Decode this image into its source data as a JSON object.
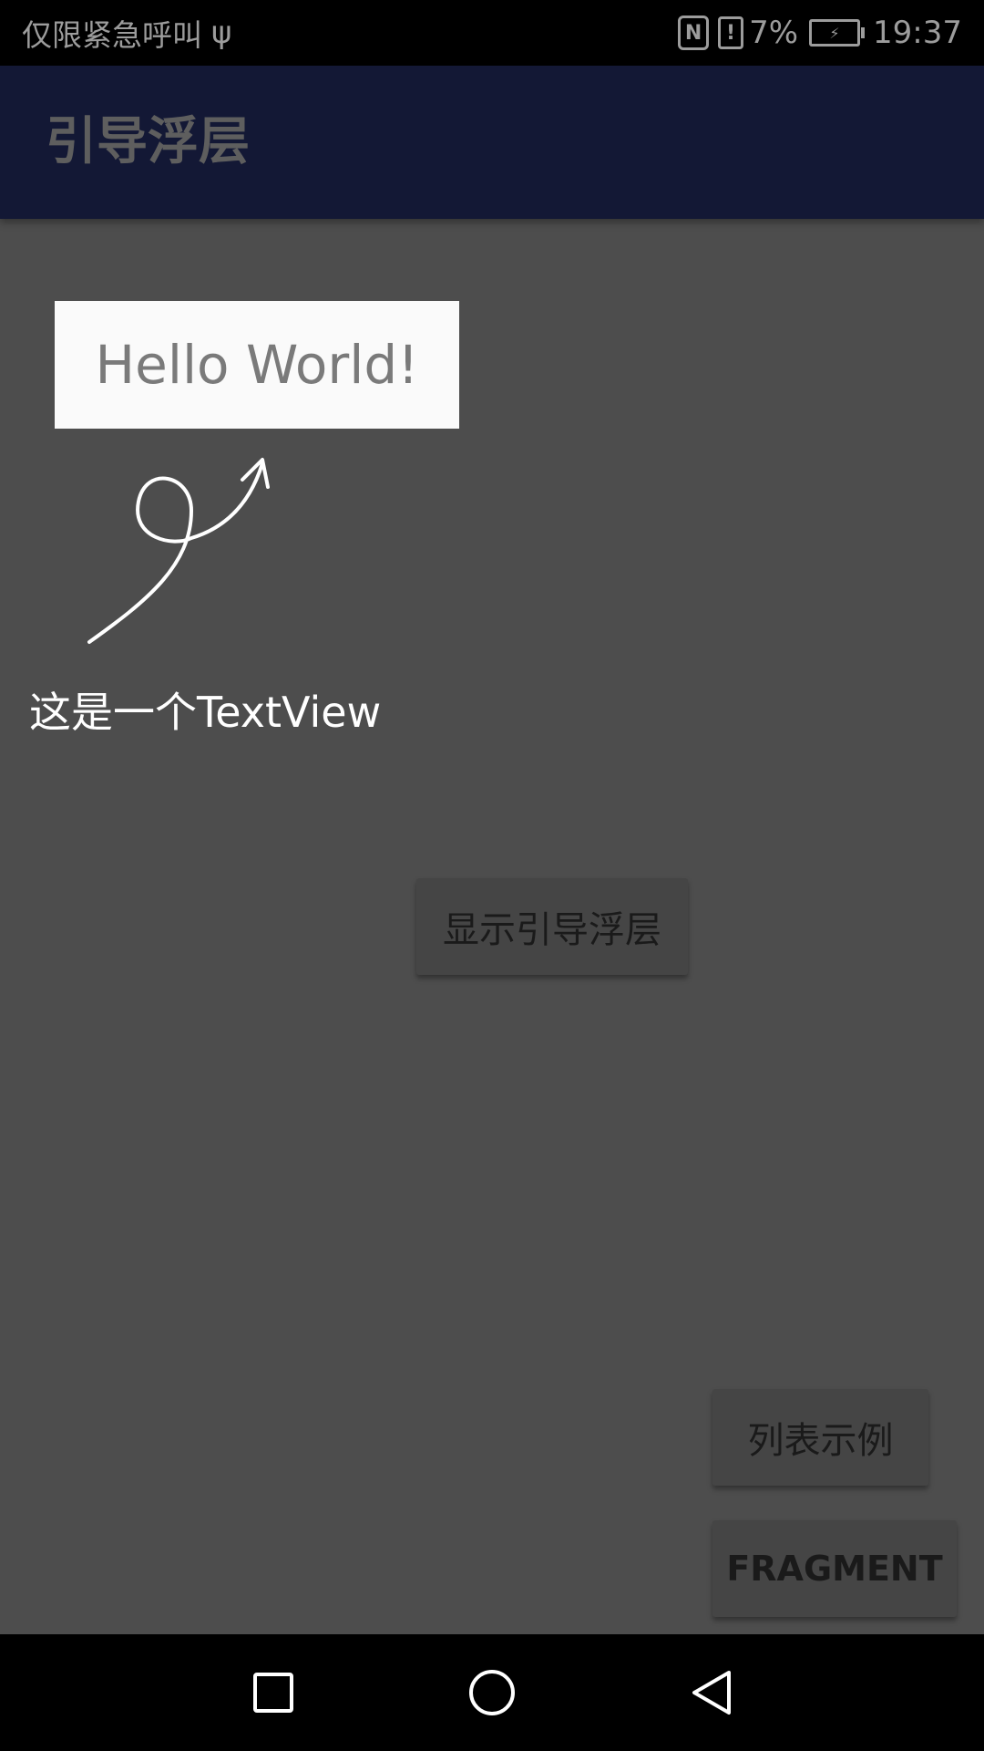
{
  "status_bar": {
    "carrier_text": "仅限紧急呼叫",
    "usb_icon": "ψ",
    "nfc_icon": "N",
    "alert_icon": "!",
    "battery_percent": "7%",
    "time": "19:37"
  },
  "app_bar": {
    "title": "引导浮层"
  },
  "content": {
    "hello_text": "Hello World!",
    "caption": "这是一个TextView",
    "show_guide_button": "显示引导浮层",
    "list_example_button": "列表示例",
    "fragment_button": "FRAGMENT"
  },
  "colors": {
    "status_bar_bg": "#000000",
    "app_bar_bg": "#131835",
    "overlay_bg": "#4d4d4d",
    "highlight_box": "#fafafa",
    "button_bg": "#454545"
  }
}
